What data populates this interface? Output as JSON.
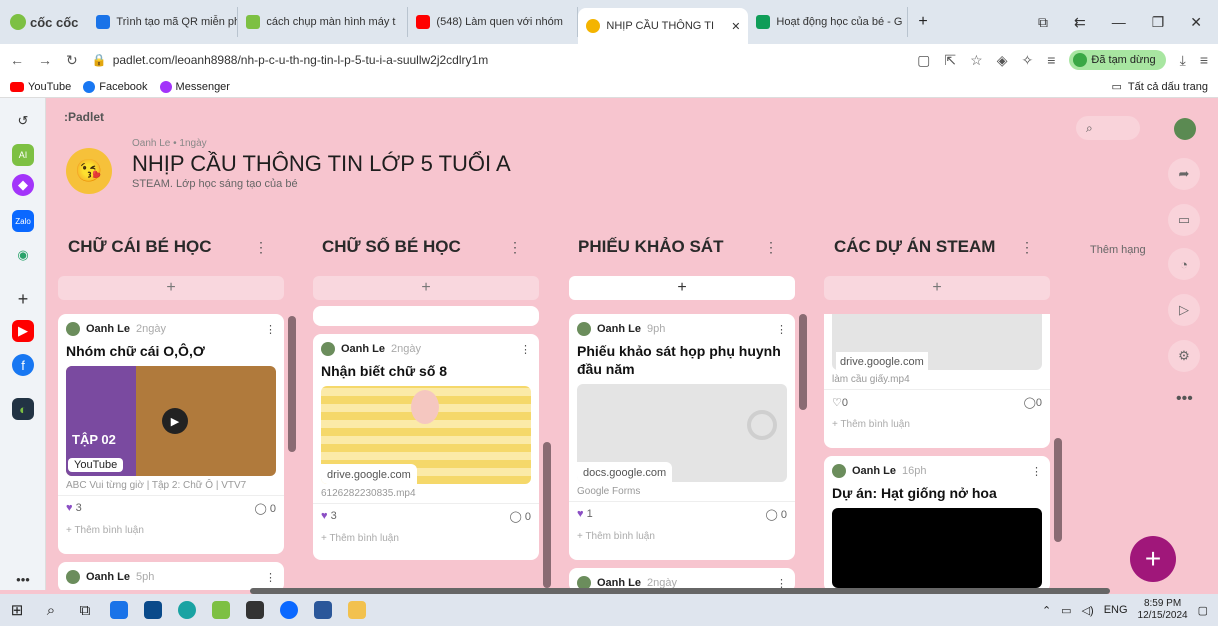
{
  "browser": {
    "brand": "cốc cốc",
    "tabs": [
      {
        "label": "Trình tạo mã QR miễn phí",
        "color": "#1a73e8"
      },
      {
        "label": "cách chụp màn hình máy t",
        "color": "#7dc043"
      },
      {
        "label": "(548) Làm quen với nhóm",
        "color": "#ff0000"
      },
      {
        "label": "NHỊP CẦU THÔNG TI",
        "color": "#f4b400",
        "active": true
      },
      {
        "label": "Hoạt động học của bé - G",
        "color": "#0f9d58"
      }
    ],
    "new_tab": "+",
    "url": "padlet.com/leoanh8988/nh-p-c-u-th-ng-tin-l-p-5-tu-i-a-suullw2j2cdlry1m",
    "pause_label": "Đã tạm dừng",
    "bookmarks": [
      "YouTube",
      "Facebook",
      "Messenger"
    ],
    "all_bookmarks": "Tất cả dấu trang"
  },
  "padlet": {
    "logo": ":Padlet",
    "author_line": "Oanh Le • 1ngày",
    "title": "NHỊP CẦU THÔNG TIN LỚP 5 TUỔI A",
    "subtitle": "STEAM. Lớp học sáng tạo của bé",
    "add_column": "Thêm hạng",
    "add_symbol": "+",
    "columns": [
      {
        "title": "CHỮ CÁI BÉ HỌC"
      },
      {
        "title": "CHỮ SỐ BÉ HỌC"
      },
      {
        "title": "PHIẾU KHẢO SÁT"
      },
      {
        "title": "CÁC DỰ ÁN STEAM"
      }
    ],
    "cards": {
      "c1": {
        "author": "Oanh Le",
        "time": "2ngày",
        "title": "Nhóm chữ cái O,Ô,Ơ",
        "badge": "YouTube",
        "thumb_text": "TẬP 02",
        "sub": "ABC Vui từng giờ | Tập 2: Chữ Ô | VTV7",
        "likes": "3",
        "comments": "0",
        "comment_prompt": "Thêm bình luận"
      },
      "c1b": {
        "author": "Oanh Le",
        "time": "5ph"
      },
      "c2": {
        "author": "Oanh Le",
        "time": "2ngày",
        "title": "Nhận biết chữ số 8",
        "source": "drive.google.com",
        "sub": "6126282230835.mp4",
        "likes": "3",
        "comments": "0",
        "comment_prompt": "Thêm bình luận"
      },
      "c3": {
        "author": "Oanh Le",
        "time": "9ph",
        "title": "Phiếu khảo sát họp phụ huynh đầu năm",
        "source": "docs.google.com",
        "sub": "Google Forms",
        "likes": "1",
        "comments": "0",
        "comment_prompt": "Thêm bình luận"
      },
      "c3b": {
        "author": "Oanh Le",
        "time": "2ngày"
      },
      "c4": {
        "source": "drive.google.com",
        "sub": "làm cầu giấy.mp4",
        "likes": "0",
        "comments": "0",
        "comment_prompt": "Thêm bình luận"
      },
      "c5": {
        "author": "Oanh Le",
        "time": "16ph",
        "title": "Dự án: Hạt giống nở hoa"
      }
    },
    "heart": "♥",
    "comment_icon": "◯",
    "more": "⋮"
  },
  "taskbar": {
    "lang": "ENG",
    "time": "8:59 PM",
    "date": "12/15/2024"
  }
}
